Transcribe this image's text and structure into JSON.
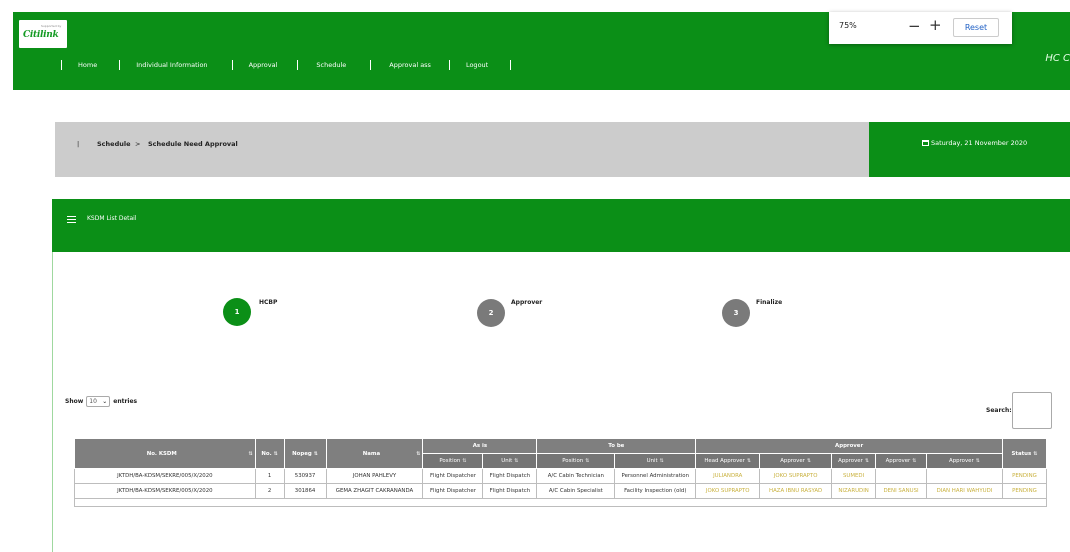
{
  "logo": {
    "brand_small": "Supported by",
    "brand": "Citilink"
  },
  "nav": [
    "Home",
    "Individual Information",
    "Approval",
    "Schedule",
    "Approval ass",
    "Logout"
  ],
  "header_user": "HC C",
  "zoom": {
    "level": "75%",
    "minus": "−",
    "plus": "+",
    "reset": "Reset"
  },
  "breadcrumb": {
    "section": "Schedule",
    "separator": ">",
    "page": "Schedule Need Approval"
  },
  "date": "Saturday, 21 November 2020",
  "panel_title": "KSDM List Detail",
  "steps": [
    {
      "number": "1",
      "label": "HCBP"
    },
    {
      "number": "2",
      "label": "Approver"
    },
    {
      "number": "3",
      "label": "Finalize"
    }
  ],
  "colors": {
    "brand_green": "#0b8f17",
    "active_step": "#0b8f17",
    "inactive_step": "#7a7a7a",
    "approver_text": "#c9b13e"
  },
  "table_controls": {
    "show_label": "Show",
    "entries_value": "10",
    "entries_label": "entries",
    "search_label": "Search:"
  },
  "table": {
    "headers": {
      "no_ksdm": "No. KSDM",
      "no": "No.",
      "nopeg": "Nopeg",
      "nama": "Nama",
      "as_is": "As is",
      "to_be": "To be",
      "approver": "Approver",
      "status": "Status",
      "position": "Position",
      "unit": "Unit",
      "head_approver": "Head Approver",
      "approver_sub": "Approver"
    },
    "rows": [
      {
        "no_ksdm": "JKTDH/BA-KDSM/SEKRE/005/X/2020",
        "no": "1",
        "nopeg": "530937",
        "nama": "JOHAN PAHLEVY",
        "asis_position": "Flight Dispatcher",
        "asis_unit": "Flight Dispatch",
        "tobe_position": "A/C Cabin Technician",
        "tobe_unit": "Personnel Administration",
        "head_approver": "JULIANDRA",
        "approver1": "JOKO SUPRAPTO",
        "approver2": "SUMEDI",
        "approver3": "",
        "approver4": "",
        "status": "PENDING"
      },
      {
        "no_ksdm": "JKTDH/BA-KDSM/SEKRE/005/X/2020",
        "no": "2",
        "nopeg": "301864",
        "nama": "GEMA ZHAGIT CAKRANANDA",
        "asis_position": "Flight Dispatcher",
        "asis_unit": "Flight Dispatch",
        "tobe_position": "A/C Cabin Specialist",
        "tobe_unit": "Facility Inspection (old)",
        "head_approver": "JOKO SUPRAPTO",
        "approver1": "HAZA IBNU RASYAD",
        "approver2": "NIZARUDIN",
        "approver3": "DENI SANUSI",
        "approver4": "DIAN HARI WAHYUDI",
        "status": "PENDING"
      }
    ]
  }
}
